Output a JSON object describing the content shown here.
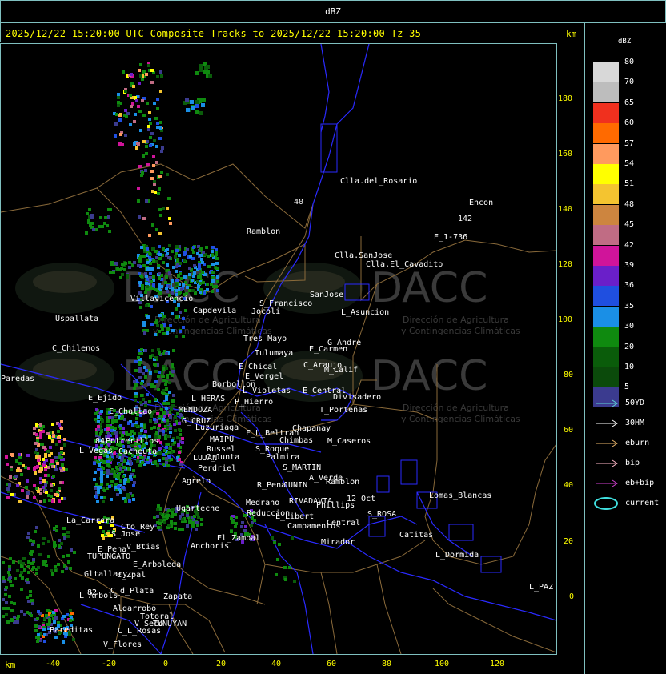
{
  "window": {
    "title": "dBZ"
  },
  "header": {
    "caption": "2025/12/22 15:20:00 UTC Composite Tracks to 2025/12/22 15:20:00 Tz 35",
    "unit": "km"
  },
  "axes": {
    "x_unit": "km",
    "x_ticks": [
      "-40",
      "-20",
      "0",
      "20",
      "40",
      "60",
      "80",
      "100",
      "120"
    ],
    "y_ticks": [
      "180",
      "160",
      "140",
      "120",
      "100",
      "80",
      "60",
      "40",
      "20",
      "0"
    ]
  },
  "legend": {
    "title": "dBZ",
    "levels": [
      {
        "value": "80",
        "color": "#d8d8d8"
      },
      {
        "value": "70",
        "color": "#bdbdbd"
      },
      {
        "value": "65",
        "color": "#f0301e"
      },
      {
        "value": "60",
        "color": "#ff6a00"
      },
      {
        "value": "57",
        "color": "#ff9a5e"
      },
      {
        "value": "54",
        "color": "#ffff00"
      },
      {
        "value": "51",
        "color": "#f4c430"
      },
      {
        "value": "48",
        "color": "#cd853f"
      },
      {
        "value": "45",
        "color": "#c06c84"
      },
      {
        "value": "42",
        "color": "#d0149a"
      },
      {
        "value": "39",
        "color": "#6a1fc9"
      },
      {
        "value": "36",
        "color": "#1f4fe0"
      },
      {
        "value": "35",
        "color": "#1a8fe6"
      },
      {
        "value": "30",
        "color": "#0f8a0f"
      },
      {
        "value": "20",
        "color": "#0a5c0a"
      },
      {
        "value": "10",
        "color": "#0b4a0b"
      },
      {
        "value": "5",
        "color": "#3b3b8f"
      }
    ],
    "tracks": [
      {
        "label": "50YD",
        "color": "#5fd6d6",
        "icon": "arrow-icon"
      },
      {
        "label": "30HM",
        "color": "#ffffff",
        "icon": "arrow-icon"
      },
      {
        "label": "eburn",
        "color": "#e8b46a",
        "icon": "arrow-icon"
      },
      {
        "label": "bip",
        "color": "#ffb8c8",
        "icon": "arrow-icon"
      },
      {
        "label": "eb+bip",
        "color": "#d040d0",
        "icon": "arrow-icon"
      },
      {
        "label": "current",
        "color": "#40e0e0",
        "icon": "ellipse-icon"
      }
    ]
  },
  "watermark": {
    "text": "DACC",
    "subtitle1": "Dirección de Agricultura",
    "subtitle2": "y Contingencias Climáticas"
  },
  "places": [
    {
      "name": "Clla.del_Rosario"
    },
    {
      "name": "Encon"
    },
    {
      "name": "142"
    },
    {
      "name": "E_1-736"
    },
    {
      "name": "Ramblon"
    },
    {
      "name": "Clla.SanJose"
    },
    {
      "name": "Clla.El_Cavadito"
    },
    {
      "name": "S_Francisco"
    },
    {
      "name": "SanJose"
    },
    {
      "name": "L_Asuncion"
    },
    {
      "name": "Villavicencio"
    },
    {
      "name": "Capdevila"
    },
    {
      "name": "Jocoli"
    },
    {
      "name": "Uspallata"
    },
    {
      "name": "Tres_Mayo"
    },
    {
      "name": "G_Andre"
    },
    {
      "name": "C_Chilenos"
    },
    {
      "name": "Tulumaya"
    },
    {
      "name": "E_Carmen"
    },
    {
      "name": "C_Araujo"
    },
    {
      "name": "M_Calif"
    },
    {
      "name": "E_Chical"
    },
    {
      "name": "E_Vergel"
    },
    {
      "name": "Borbollon"
    },
    {
      "name": "L_Violetas"
    },
    {
      "name": "E_Central"
    },
    {
      "name": "Divisadero"
    },
    {
      "name": "Paredas"
    },
    {
      "name": "L_HERAS"
    },
    {
      "name": "P_Hierro"
    },
    {
      "name": "T_Porteñas"
    },
    {
      "name": "E_Ejido"
    },
    {
      "name": "MENDOZA"
    },
    {
      "name": "E_Challao"
    },
    {
      "name": "G_CRUZ"
    },
    {
      "name": "Chapanay"
    },
    {
      "name": "Luzuriaga"
    },
    {
      "name": "F_L_Beltran"
    },
    {
      "name": "Chimbas"
    },
    {
      "name": "M_Caseros"
    },
    {
      "name": "Potrerillos"
    },
    {
      "name": "MAIPU"
    },
    {
      "name": "Russel"
    },
    {
      "name": "S_Roque"
    },
    {
      "name": "Cacheuta"
    },
    {
      "name": "L_Vegas"
    },
    {
      "name": "LUJAN"
    },
    {
      "name": "C_Junta"
    },
    {
      "name": "Palmira"
    },
    {
      "name": "Perdriel"
    },
    {
      "name": "S_MARTIN"
    },
    {
      "name": "A_Verde"
    },
    {
      "name": "Agrelo"
    },
    {
      "name": "R_Pena"
    },
    {
      "name": "JUNIN"
    },
    {
      "name": "Ramblon"
    },
    {
      "name": "Lomas_Blancas"
    },
    {
      "name": "Ugarteche"
    },
    {
      "name": "Medrano"
    },
    {
      "name": "RIVADAVIA"
    },
    {
      "name": "Phillips"
    },
    {
      "name": "12_Oct"
    },
    {
      "name": "Reduccion"
    },
    {
      "name": "La_Carrera"
    },
    {
      "name": "L_Libert"
    },
    {
      "name": "S_ROSA"
    },
    {
      "name": "Cto_Rey"
    },
    {
      "name": "Campamentos"
    },
    {
      "name": "Central"
    },
    {
      "name": "S_Jose"
    },
    {
      "name": "El_Zampal"
    },
    {
      "name": "Catitas"
    },
    {
      "name": "V_Btias"
    },
    {
      "name": "Anchoris"
    },
    {
      "name": "E_Pena"
    },
    {
      "name": "Mirador"
    },
    {
      "name": "TUPUNGATO"
    },
    {
      "name": "L_Dormida"
    },
    {
      "name": "E_Arboleda"
    },
    {
      "name": "Gltallary"
    },
    {
      "name": "E_Zpal"
    },
    {
      "name": "L_PAZ"
    },
    {
      "name": "C_d_Plata"
    },
    {
      "name": "L_Arbols"
    },
    {
      "name": "Zapata"
    },
    {
      "name": "Algarrobo"
    },
    {
      "name": "Totoral"
    },
    {
      "name": "V_Seco"
    },
    {
      "name": "TUNUYAN"
    },
    {
      "name": "C_L_Rosas"
    },
    {
      "name": "Pareditas"
    },
    {
      "name": "V_Flores"
    },
    {
      "name": "40"
    },
    {
      "name": "84"
    },
    {
      "name": "82"
    }
  ]
}
